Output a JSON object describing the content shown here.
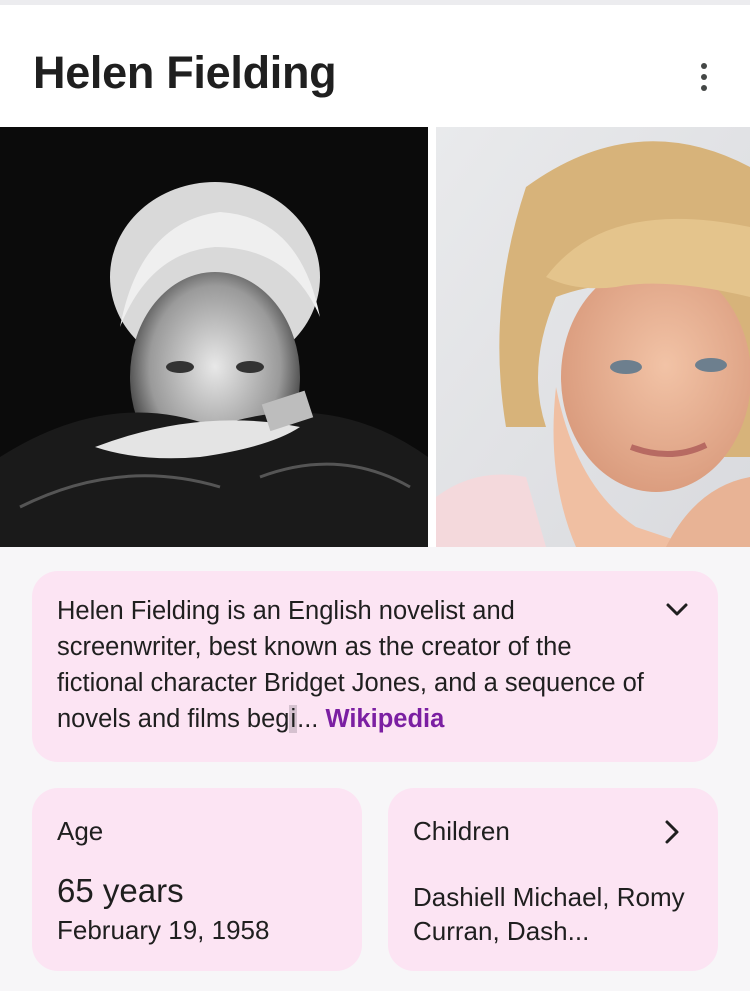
{
  "header": {
    "title": "Helen Fielding",
    "more_icon": "more-vert-icon"
  },
  "photos": [
    {
      "name": "photo-black-and-white",
      "style": "grayscale portrait"
    },
    {
      "name": "photo-color",
      "style": "color portrait"
    }
  ],
  "description": {
    "text": "Helen Fielding is an English novelist and screenwriter, best known as the creator of the fictional character Bridget Jones, and a sequence of novels and films beg",
    "selected_char": "i",
    "ellipsis": "...",
    "source": "Wikipedia",
    "expand_icon": "chevron-down-icon"
  },
  "facts": {
    "age": {
      "label": "Age",
      "value": "65 years",
      "date": "February 19, 1958"
    },
    "children": {
      "label": "Children",
      "value": "Dashiell Michael, Romy Curran, Dash...",
      "icon": "chevron-right-icon"
    }
  },
  "colors": {
    "card_bg": "#fce4f3",
    "link": "#7b1fa2",
    "page_bg": "#f7f6f8"
  }
}
